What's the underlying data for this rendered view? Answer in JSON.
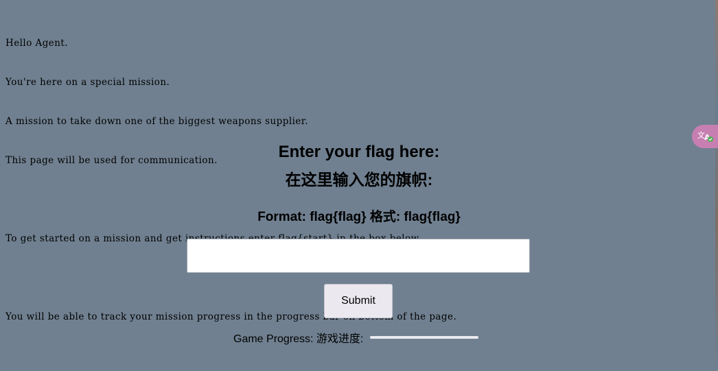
{
  "intro": {
    "lines": [
      "Hello Agent.",
      "You're here on a special mission.",
      "A mission to take down one of the biggest weapons supplier.",
      "This page will be used for communication.",
      "",
      "To get started on a mission and get instructions enter flag{start} in the box below.",
      "",
      "You will be able to track your mission progress in the progress bar on bottom of the page."
    ]
  },
  "form": {
    "heading_en": "Enter your flag here:",
    "heading_zh": "在这里输入您的旗帜:",
    "format_text": "Format: flag{flag} 格式: flag{flag}",
    "input_value": "",
    "input_placeholder": "",
    "submit_label": "Submit"
  },
  "progress": {
    "label": "Game Progress: 游戏进度:",
    "value": 0
  },
  "widget": {
    "icon": "translate-icon",
    "color": "#c77fb2"
  },
  "colors": {
    "background": "#708090"
  }
}
